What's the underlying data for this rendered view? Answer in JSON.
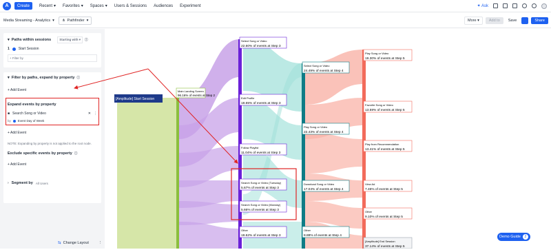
{
  "topbar": {
    "create_label": "Create",
    "nav": [
      "Recent",
      "Favorites",
      "Spaces",
      "Users & Sessions",
      "Audiences",
      "Experiment"
    ],
    "ask_label": "Ask"
  },
  "subbar": {
    "project": "Media Streaming - Analytics",
    "chart_type": "Pathfinder",
    "more_label": "More",
    "add_to_label": "Add to",
    "save_label": "Save",
    "share_label": "Share"
  },
  "sidebar": {
    "paths_title": "Paths within sessions",
    "starting_with": "Starting with",
    "step_number": "1",
    "start_event": "Start Session",
    "filter_by_placeholder": "+ Filter by",
    "filter_section_title": "Filter by paths, expand by property",
    "add_event_1": "+ Add Event",
    "expand_title": "Expand events by property",
    "expand_event": "Search Song or Video",
    "expand_by_label": "by",
    "expand_property": "Event Day of Week",
    "add_event_2": "+ Add Event",
    "note": "NOTE: Expanding by property is not applied to the root node.",
    "exclude_title": "Exclude specific events by property",
    "add_event_3": "+ Add Event",
    "segment_title": "Segment by",
    "segment_value": "All Users",
    "change_layout": "Change Layout"
  },
  "chart": {
    "nodes": [
      {
        "label": "[Amplitude] Start Session",
        "pct": ""
      },
      {
        "label": "Main Landing Screen",
        "pct": "96.16% of events at Step 2"
      },
      {
        "label": "Select Song or Video",
        "pct": "22.60% of events at Step 3"
      },
      {
        "label": "Edit Profile",
        "pct": "18.65% of events at Step 3"
      },
      {
        "label": "Follow Playlist",
        "pct": "11.04% of events at Step 3"
      },
      {
        "label": "Search Song or Video (Tuesday)",
        "pct": "5.67% of events at Step 3"
      },
      {
        "label": "Search Song or Video (Monday)",
        "pct": "5.66% of events at Step 3"
      },
      {
        "label": "Other",
        "pct": "19.62% of events at Step 3"
      },
      {
        "label": "Select Song or Video",
        "pct": "24.49% of events at Step 4"
      },
      {
        "label": "Play Song or Video",
        "pct": "22.43% of events at Step 4"
      },
      {
        "label": "Download Song or Video",
        "pct": "17.04% of events at Step 4"
      },
      {
        "label": "Other",
        "pct": "8.88% of events at Step 4"
      },
      {
        "label": "Play Song or Video",
        "pct": "19.30% of events at Step 5"
      },
      {
        "label": "Favorite Song or Video",
        "pct": "13.59% of events at Step 5"
      },
      {
        "label": "Play from Recommendation",
        "pct": "13.41% of events at Step 5"
      },
      {
        "label": "View Ad",
        "pct": "7.46% of events at Step 5"
      },
      {
        "label": "Other",
        "pct": "9.10% of events at Step 5"
      },
      {
        "label": "[Amplitude] End Session",
        "pct": "37.14% of events at Step 5"
      }
    ]
  },
  "demo_guide": {
    "label": "Demo Guide",
    "count": "2"
  },
  "colors": {
    "accent": "#1e61f0",
    "annotation_red": "#e02424",
    "purple": "#7e3ff2",
    "teal": "#0e7c86",
    "salmon": "#f26b5b",
    "green": "#b8d68a"
  }
}
